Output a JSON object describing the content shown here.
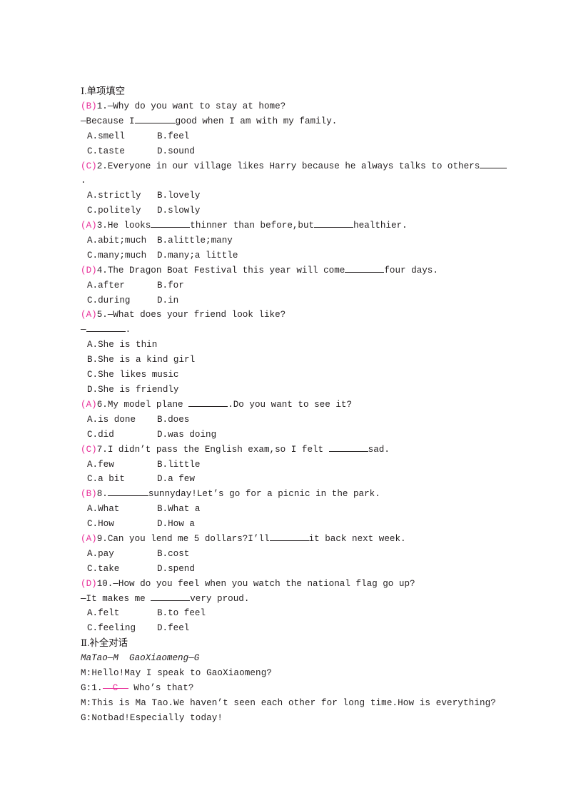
{
  "document": {
    "type": "english-exam-worksheet",
    "answer_color": "#e8309a",
    "text_color": "#231f20"
  },
  "sections": [
    {
      "id": "section-1",
      "heading": "Ⅰ.单项填空",
      "questions": [
        {
          "answer": "B",
          "number": "1.",
          "stem_parts": [
            "—Why do you want to stay at home?"
          ],
          "stem_line2_pre": "—Because I",
          "stem_line2_post": "good when I am with my family.",
          "options": [
            {
              "key": "A.",
              "text": "smell"
            },
            {
              "key": "B.",
              "text": "feel"
            },
            {
              "key": "C.",
              "text": "taste"
            },
            {
              "key": "D.",
              "text": "sound"
            }
          ]
        },
        {
          "answer": "C",
          "number": "2.",
          "stem_parts": [
            "Everyone in our village likes Harry because he always talks to others"
          ],
          "stem_tail": ".",
          "options": [
            {
              "key": "A.",
              "text": "strictly"
            },
            {
              "key": "B.",
              "text": "lovely"
            },
            {
              "key": "C.",
              "text": "politely"
            },
            {
              "key": "D.",
              "text": "slowly"
            }
          ]
        },
        {
          "answer": "A",
          "number": "3.",
          "stem_pre": "He looks",
          "stem_mid": "thinner than before,but",
          "stem_post": "healthier.",
          "options": [
            {
              "key": "A.",
              "text": "abit;much"
            },
            {
              "key": "B.",
              "text": "alittle;many"
            },
            {
              "key": "C.",
              "text": "many;much"
            },
            {
              "key": "D.",
              "text": "many;a little"
            }
          ]
        },
        {
          "answer": "D",
          "number": "4.",
          "stem_pre": "The Dragon Boat Festival this year will come",
          "stem_post": "four days.",
          "options": [
            {
              "key": "A.",
              "text": "after"
            },
            {
              "key": "B.",
              "text": "for"
            },
            {
              "key": "C.",
              "text": "during"
            },
            {
              "key": "D.",
              "text": "in"
            }
          ]
        },
        {
          "answer": "A",
          "number": "5.",
          "stem_parts": [
            "—What does your friend look like?"
          ],
          "stem_line2_pre": "—",
          "stem_line2_post": ".",
          "options_single": [
            {
              "key": "A.",
              "text": "She is thin"
            },
            {
              "key": "B.",
              "text": "She is a kind girl"
            },
            {
              "key": "C.",
              "text": "She likes music"
            },
            {
              "key": "D.",
              "text": "She is friendly"
            }
          ]
        },
        {
          "answer": "A",
          "number": "6.",
          "stem_pre": "My model plane ",
          "stem_post": ".Do you want to see it?",
          "options": [
            {
              "key": "A.",
              "text": "is done"
            },
            {
              "key": "B.",
              "text": "does"
            },
            {
              "key": "C.",
              "text": "did"
            },
            {
              "key": "D.",
              "text": "was doing"
            }
          ]
        },
        {
          "answer": "C",
          "number": "7.",
          "stem_pre": "I didn’t pass the English exam,so I felt ",
          "stem_post": "sad.",
          "options": [
            {
              "key": "A.",
              "text": "few"
            },
            {
              "key": "B.",
              "text": "little"
            },
            {
              "key": "C.",
              "text": "a bit"
            },
            {
              "key": "D.",
              "text": "a few"
            }
          ]
        },
        {
          "answer": "B",
          "number": "8.",
          "stem_pre": "",
          "stem_post": "sunnyday!Let’s go for a picnic in the park.",
          "options": [
            {
              "key": "A.",
              "text": "What"
            },
            {
              "key": "B.",
              "text": "What a"
            },
            {
              "key": "C.",
              "text": "How"
            },
            {
              "key": "D.",
              "text": "How a"
            }
          ]
        },
        {
          "answer": "A",
          "number": "9.",
          "stem_pre": "Can you lend me 5 dollars?I’ll",
          "stem_post": "it back next week.",
          "options": [
            {
              "key": "A.",
              "text": "pay"
            },
            {
              "key": "B.",
              "text": "cost"
            },
            {
              "key": "C.",
              "text": "take"
            },
            {
              "key": "D.",
              "text": "spend"
            }
          ]
        },
        {
          "answer": "D",
          "number": "10.",
          "stem_parts": [
            "—How do you feel when you watch the national flag go up?"
          ],
          "stem_line2_pre": "—It makes me ",
          "stem_line2_post": "very proud.",
          "options": [
            {
              "key": "A.",
              "text": "felt"
            },
            {
              "key": "B.",
              "text": "to feel"
            },
            {
              "key": "C.",
              "text": "feeling"
            },
            {
              "key": "D.",
              "text": "feel"
            }
          ]
        }
      ]
    },
    {
      "id": "section-2",
      "heading": "Ⅱ.补全对话",
      "speakers_note": "MaTao—M  GaoXiaomeng—G",
      "dialogue": [
        {
          "line": "M:Hello!May I speak to GaoXiaomeng?"
        },
        {
          "pre": "G:1.",
          "answer": "C",
          "post": " Who’s that?"
        },
        {
          "line": "M:This is Ma Tao.We haven’t seen each other for long time.How is everything?"
        },
        {
          "line": "G:Notbad!Especially today!"
        }
      ]
    }
  ]
}
